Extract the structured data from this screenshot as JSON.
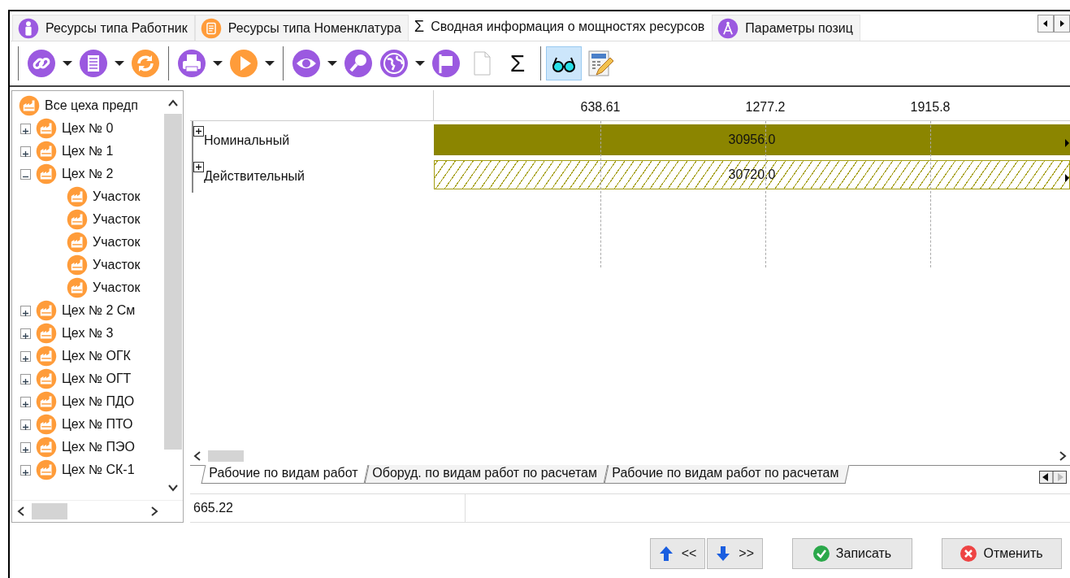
{
  "tabs": [
    {
      "label": "Ресурсы типа Работник",
      "selected": false
    },
    {
      "label": "Ресурсы типа Номенклатура",
      "selected": false
    },
    {
      "label": "Сводная информация о мощностях ресурсов",
      "selected": true,
      "glyph": "Σ"
    },
    {
      "label": "Параметры позиц",
      "selected": false
    }
  ],
  "toolbar": [
    [
      {
        "dropdown": true,
        "pressed": false
      },
      {
        "dropdown": true,
        "pressed": false
      },
      {
        "dropdown": false,
        "pressed": false
      }
    ],
    [
      {
        "dropdown": true,
        "pressed": false
      },
      {
        "dropdown": true,
        "pressed": false
      }
    ],
    [
      {
        "dropdown": true,
        "pressed": false
      },
      {
        "dropdown": false,
        "pressed": false
      },
      {
        "dropdown": true,
        "pressed": false
      },
      {
        "dropdown": false,
        "pressed": false
      },
      {
        "dropdown": false,
        "pressed": false
      },
      {
        "glyph": "Σ",
        "dropdown": false,
        "pressed": false
      }
    ],
    [
      {
        "dropdown": false,
        "pressed": true
      },
      {
        "dropdown": false,
        "pressed": false
      }
    ]
  ],
  "tree": {
    "label": "Все цеха предп",
    "children": [
      {
        "label": "Цех № 0",
        "expanded": false
      },
      {
        "label": "Цех № 1",
        "expanded": false
      },
      {
        "label": "Цех № 2",
        "expanded": true,
        "children": [
          {
            "label": "Участок"
          },
          {
            "label": "Участок"
          },
          {
            "label": "Участок"
          },
          {
            "label": "Участок"
          },
          {
            "label": "Участок"
          }
        ]
      },
      {
        "label": "Цех № 2 См",
        "expanded": false
      },
      {
        "label": "Цех № 3",
        "expanded": false
      },
      {
        "label": "Цех № ОГК",
        "expanded": false
      },
      {
        "label": "Цех № ОГТ",
        "expanded": false
      },
      {
        "label": "Цех № ПДО",
        "expanded": false
      },
      {
        "label": "Цех № ПТО",
        "expanded": false
      },
      {
        "label": "Цех № ПЭО",
        "expanded": false
      },
      {
        "label": "Цех № СК-1",
        "expanded": false
      }
    ]
  },
  "chart": {
    "ticks": [
      "638.61",
      "1277.2",
      "1915.8"
    ],
    "rows": [
      {
        "label": "Номинальный",
        "expanded": false,
        "kind": "solid",
        "value": "30956.0"
      },
      {
        "label": "Действительный",
        "expanded": false,
        "kind": "hatched",
        "value": "30720.0"
      }
    ]
  },
  "sheet_tabs": [
    {
      "label": "Рабочие по видам работ",
      "selected": true
    },
    {
      "label": "Оборуд. по видам работ по расчетам",
      "selected": false
    },
    {
      "label": "Рабочие по видам работ по расчетам",
      "selected": false
    }
  ],
  "status_bar": {
    "value": "665.22"
  },
  "buttons": [
    {
      "kind": "prev",
      "label": "<<"
    },
    {
      "kind": "next",
      "label": ">>"
    },
    {
      "kind": "save",
      "label": "Записать"
    },
    {
      "kind": "cancel",
      "label": "Отменить"
    }
  ]
}
